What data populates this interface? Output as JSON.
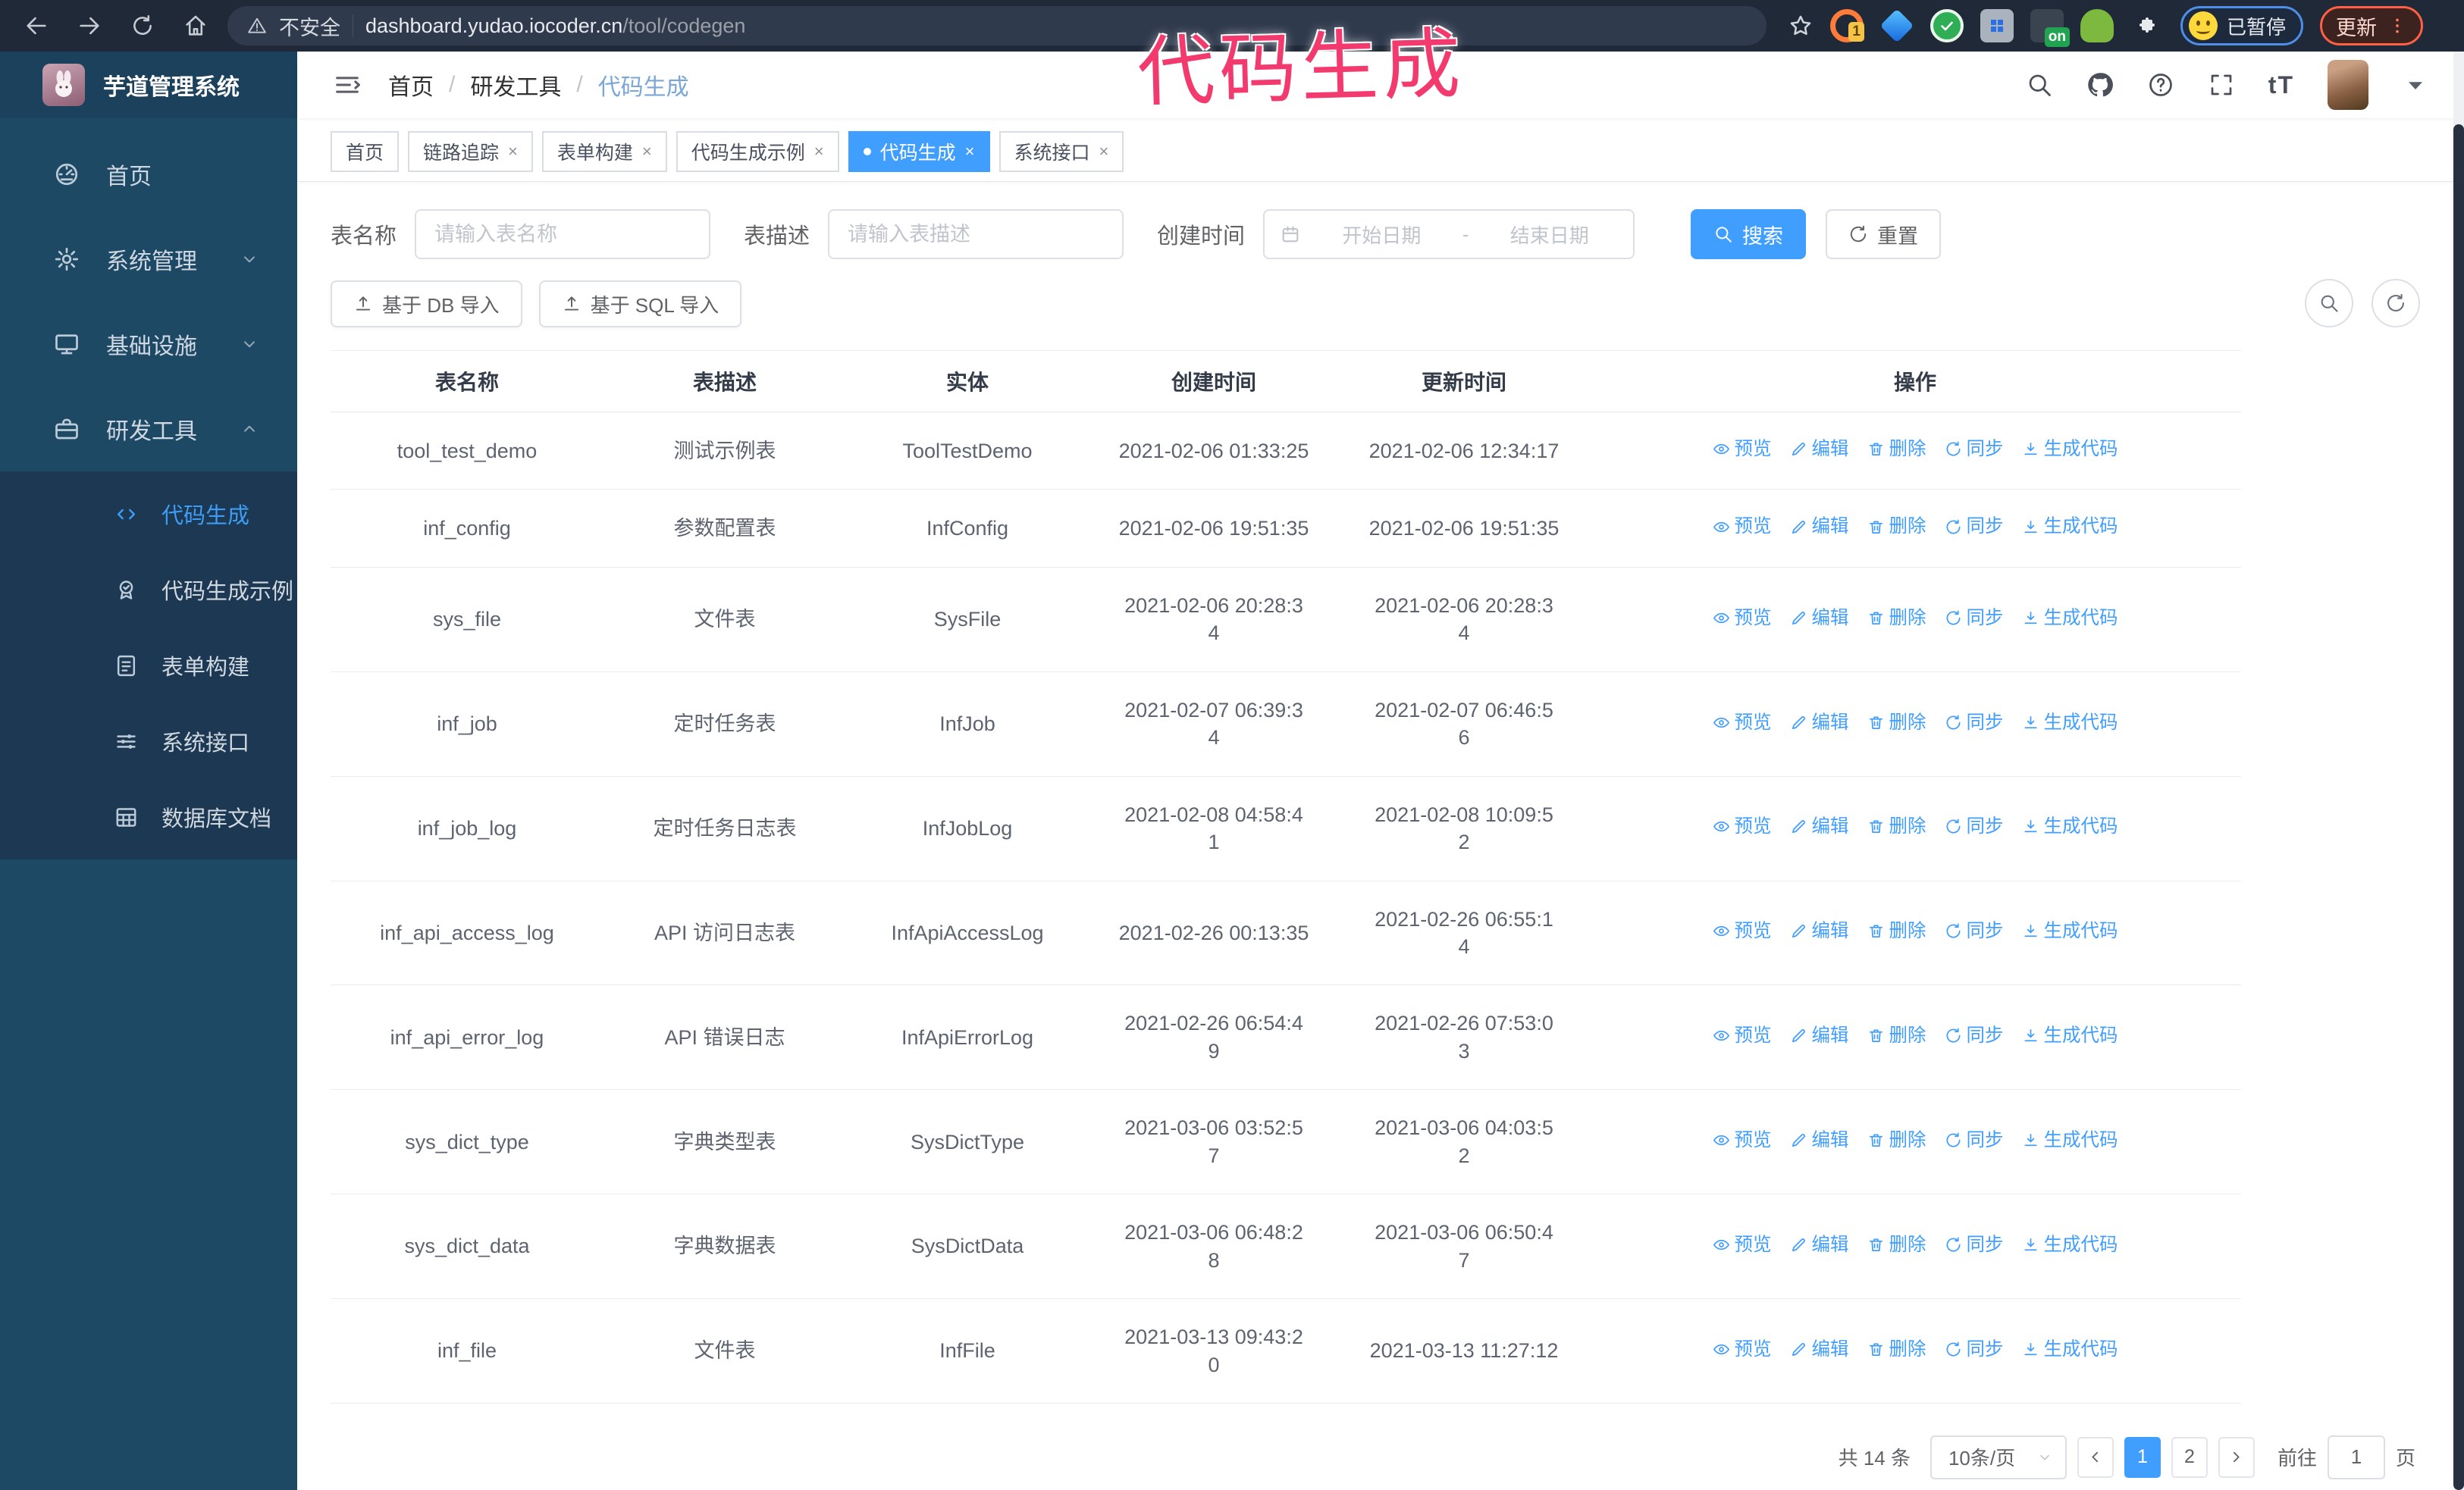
{
  "annotation": {
    "text": "代码生成",
    "color": "#f23a6e"
  },
  "browser": {
    "security_label": "不安全",
    "url_host": "dashboard.yudao.iocoder.cn",
    "url_path": "/tool/codegen",
    "extension_badge_count": "1",
    "extension_badge_on": "on",
    "paused_label": "已暂停",
    "update_label": "更新"
  },
  "sidebar": {
    "title": "芋道管理系统",
    "items": [
      {
        "label": "首页",
        "icon": "dashboard",
        "chevron": ""
      },
      {
        "label": "系统管理",
        "icon": "gear",
        "chevron": "chevdown"
      },
      {
        "label": "基础设施",
        "icon": "monitor",
        "chevron": "chevdown"
      },
      {
        "label": "研发工具",
        "icon": "toolbox",
        "chevron": "chevup"
      }
    ],
    "submenu": [
      {
        "label": "代码生成",
        "icon": "code",
        "active": true
      },
      {
        "label": "代码生成示例",
        "icon": "medal",
        "active": false
      },
      {
        "label": "表单构建",
        "icon": "form",
        "active": false
      },
      {
        "label": "系统接口",
        "icon": "api",
        "active": false
      },
      {
        "label": "数据库文档",
        "icon": "dbdoc",
        "active": false
      }
    ]
  },
  "header": {
    "breadcrumb": [
      "首页",
      "研发工具",
      "代码生成"
    ],
    "font_size_label": "tT"
  },
  "tabs": [
    {
      "label": "首页",
      "closable": false,
      "active": false
    },
    {
      "label": "链路追踪",
      "closable": true,
      "active": false
    },
    {
      "label": "表单构建",
      "closable": true,
      "active": false
    },
    {
      "label": "代码生成示例",
      "closable": true,
      "active": false
    },
    {
      "label": "代码生成",
      "closable": true,
      "active": true
    },
    {
      "label": "系统接口",
      "closable": true,
      "active": false
    }
  ],
  "filters": {
    "table_name_label": "表名称",
    "table_name_placeholder": "请输入表名称",
    "table_desc_label": "表描述",
    "table_desc_placeholder": "请输入表描述",
    "create_time_label": "创建时间",
    "start_placeholder": "开始日期",
    "range_separator": "-",
    "end_placeholder": "结束日期",
    "search_label": "搜索",
    "reset_label": "重置"
  },
  "toolbar": {
    "import_db_label": "基于 DB 导入",
    "import_sql_label": "基于 SQL 导入"
  },
  "table": {
    "columns": [
      "表名称",
      "表描述",
      "实体",
      "创建时间",
      "更新时间",
      "操作"
    ],
    "actions": [
      "预览",
      "编辑",
      "删除",
      "同步",
      "生成代码"
    ],
    "rows": [
      {
        "name": "tool_test_demo",
        "description": "测试示例表",
        "entity": "ToolTestDemo",
        "created": [
          "2021-02-06 01:33:25"
        ],
        "updated": [
          "2021-02-06 12:34:17"
        ]
      },
      {
        "name": "inf_config",
        "description": "参数配置表",
        "entity": "InfConfig",
        "created": [
          "2021-02-06 19:51:35"
        ],
        "updated": [
          "2021-02-06 19:51:35"
        ]
      },
      {
        "name": "sys_file",
        "description": "文件表",
        "entity": "SysFile",
        "created": [
          "2021-02-06 20:28:3",
          "4"
        ],
        "updated": [
          "2021-02-06 20:28:3",
          "4"
        ]
      },
      {
        "name": "inf_job",
        "description": "定时任务表",
        "entity": "InfJob",
        "created": [
          "2021-02-07 06:39:3",
          "4"
        ],
        "updated": [
          "2021-02-07 06:46:5",
          "6"
        ]
      },
      {
        "name": "inf_job_log",
        "description": "定时任务日志表",
        "entity": "InfJobLog",
        "created": [
          "2021-02-08 04:58:4",
          "1"
        ],
        "updated": [
          "2021-02-08 10:09:5",
          "2"
        ]
      },
      {
        "name": "inf_api_access_log",
        "description": "API 访问日志表",
        "entity": "InfApiAccessLog",
        "created": [
          "2021-02-26 00:13:35"
        ],
        "updated": [
          "2021-02-26 06:55:1",
          "4"
        ]
      },
      {
        "name": "inf_api_error_log",
        "description": "API 错误日志",
        "entity": "InfApiErrorLog",
        "created": [
          "2021-02-26 06:54:4",
          "9"
        ],
        "updated": [
          "2021-02-26 07:53:0",
          "3"
        ]
      },
      {
        "name": "sys_dict_type",
        "description": "字典类型表",
        "entity": "SysDictType",
        "created": [
          "2021-03-06 03:52:5",
          "7"
        ],
        "updated": [
          "2021-03-06 04:03:5",
          "2"
        ]
      },
      {
        "name": "sys_dict_data",
        "description": "字典数据表",
        "entity": "SysDictData",
        "created": [
          "2021-03-06 06:48:2",
          "8"
        ],
        "updated": [
          "2021-03-06 06:50:4",
          "7"
        ]
      },
      {
        "name": "inf_file",
        "description": "文件表",
        "entity": "InfFile",
        "created": [
          "2021-03-13 09:43:2",
          "0"
        ],
        "updated": [
          "2021-03-13 11:27:12"
        ]
      }
    ]
  },
  "pagination": {
    "total_label": "共 14 条",
    "page_size": "10条/页",
    "pages": [
      "1",
      "2"
    ],
    "active_page": "1",
    "goto_label": "前往",
    "goto_value": "1",
    "page_label": "页"
  },
  "colors": {
    "accent_blue": "#409eff",
    "sidebar_bg": "#1e4965",
    "submenu_bg": "#1d3852",
    "chrome_bg": "#202938",
    "annotation_pink": "#f23a6e"
  }
}
